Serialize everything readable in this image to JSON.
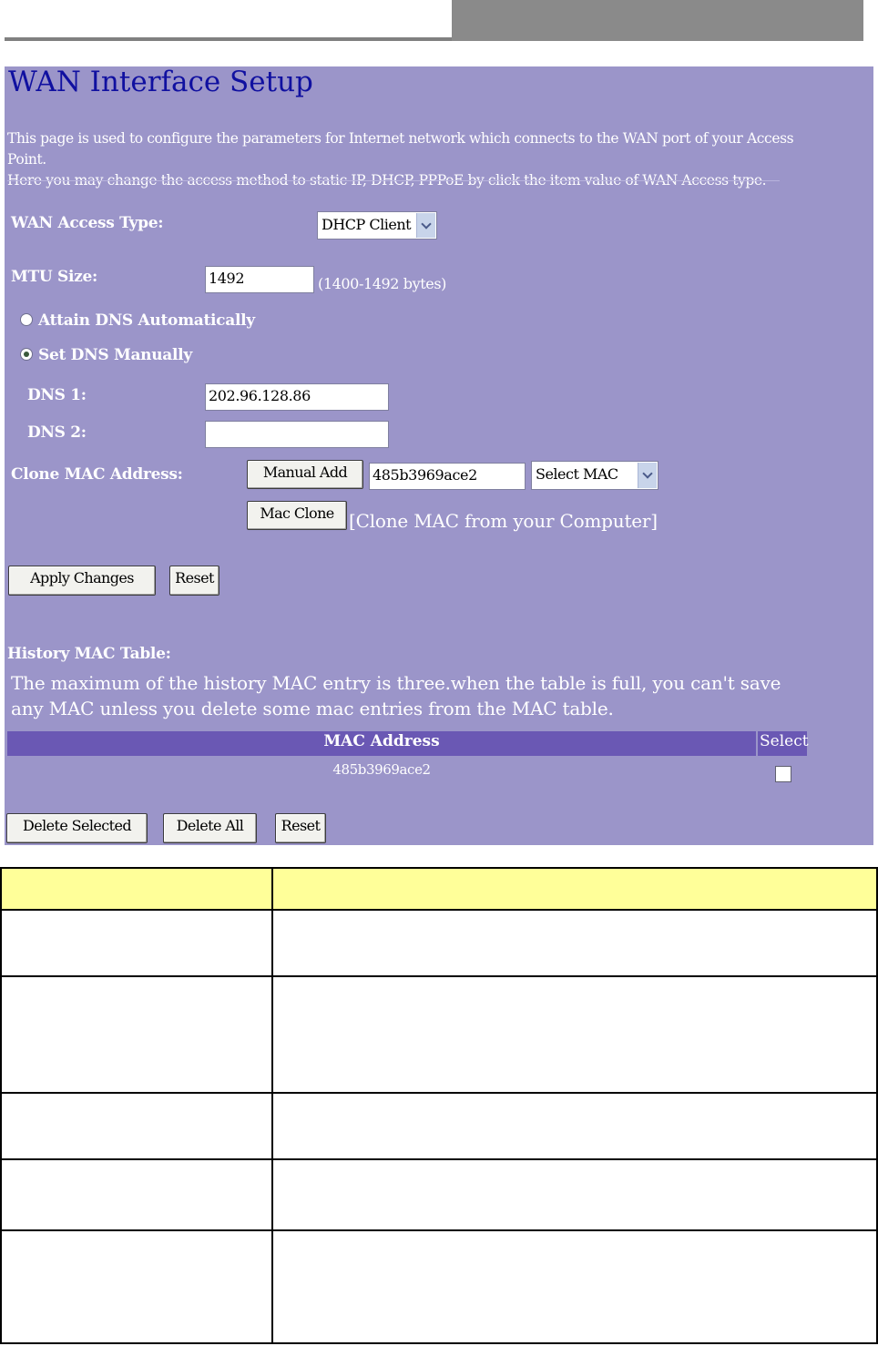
{
  "page": {
    "title": "WAN Interface Setup",
    "intro_line1": "This page is used to configure the parameters for Internet network which connects to the WAN port of your Access Point.",
    "intro_line2": "Here you may change the access method to static IP, DHCP, PPPoE by click the item value of WAN Access type."
  },
  "form": {
    "wan_access_type_label": "WAN Access Type:",
    "wan_access_type_value": "DHCP Client",
    "mtu_label": "MTU Size:",
    "mtu_value": "1492",
    "mtu_hint": "(1400-1492 bytes)",
    "dns_auto_label": "Attain DNS Automatically",
    "dns_manual_label": "Set DNS Manually",
    "dns_mode": "manual",
    "dns1_label": "DNS 1:",
    "dns1_value": "202.96.128.86",
    "dns2_label": "DNS 2:",
    "dns2_value": "",
    "clone_mac_label": "Clone MAC Address:",
    "manual_add_button": "Manual Add",
    "mac_value": "485b3969ace2",
    "select_mac_value": "Select MAC",
    "mac_clone_button": "Mac Clone",
    "mac_clone_hint": "[Clone MAC from your Computer]",
    "apply_button": "Apply Changes",
    "reset_button": "Reset"
  },
  "history": {
    "heading": "History MAC Table:",
    "note_line1": "The maximum of the history MAC entry is three.when the table is full, you can't save",
    "note_line2": "any MAC unless you delete some mac entries from the MAC table.",
    "col_mac": "MAC Address",
    "col_select": "Select",
    "rows": [
      {
        "mac": "485b3969ace2",
        "selected": false
      }
    ],
    "delete_selected_button": "Delete Selected",
    "delete_all_button": "Delete All",
    "reset_button": "Reset"
  },
  "colors": {
    "panel": "#9b95c9",
    "title": "#1010a0",
    "table_header": "#6a58b4",
    "desc_header": "#ffff99"
  }
}
